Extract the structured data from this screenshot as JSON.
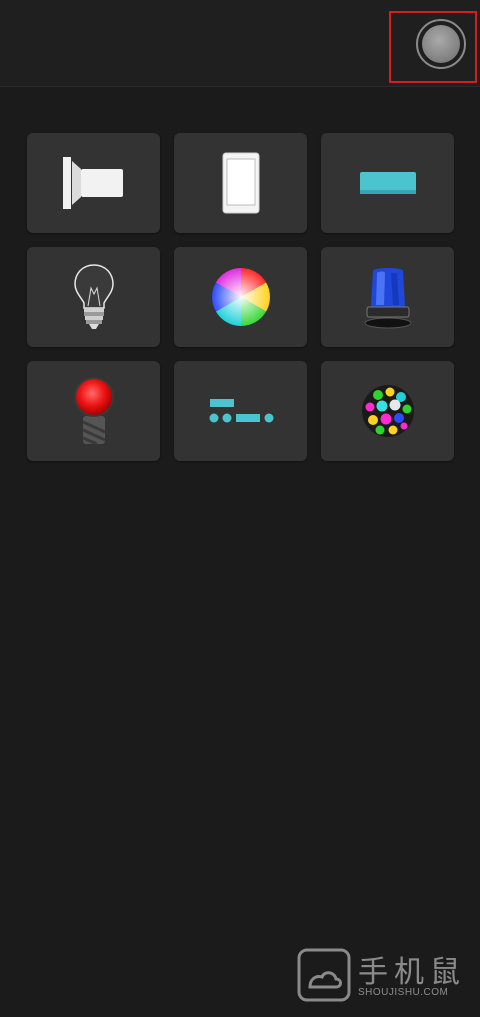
{
  "header": {
    "toggle_icon": "light-toggle-icon"
  },
  "tiles": [
    {
      "icon": "flashlight-icon"
    },
    {
      "icon": "phone-screen-icon"
    },
    {
      "icon": "color-bar-icon"
    },
    {
      "icon": "lightbulb-icon"
    },
    {
      "icon": "color-wheel-icon"
    },
    {
      "icon": "police-light-icon"
    },
    {
      "icon": "red-led-icon"
    },
    {
      "icon": "morse-code-icon"
    },
    {
      "icon": "disco-ball-icon"
    }
  ],
  "colors": {
    "background": "#1b1b1b",
    "tile": "#333333",
    "accent_cyan": "#4cc4d0",
    "highlight_red": "#d61e1e"
  },
  "watermark": {
    "text": "手机鼠",
    "sub": "SHOUJISHU.COM"
  }
}
